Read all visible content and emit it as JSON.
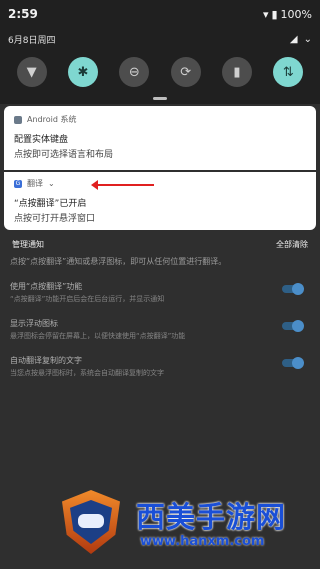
{
  "status": {
    "time": "2:59",
    "battery": "100%"
  },
  "qs": {
    "date": "6月8日周四",
    "tiles": [
      {
        "name": "wifi-icon",
        "glyph": "▼",
        "on": false
      },
      {
        "name": "bluetooth-icon",
        "glyph": "✱",
        "on": true
      },
      {
        "name": "dnd-icon",
        "glyph": "⊖",
        "on": false
      },
      {
        "name": "rotate-icon",
        "glyph": "⟳",
        "on": false
      },
      {
        "name": "battery-saver-icon",
        "glyph": "▮",
        "on": false
      },
      {
        "name": "data-icon",
        "glyph": "⇅",
        "on": true
      }
    ]
  },
  "notifications": [
    {
      "app": "Android 系统",
      "title": "配置实体键盘",
      "text": "点按即可选择语言和布局"
    },
    {
      "app": "翻译",
      "title": "“点按翻译”已开启",
      "text": "点按可打开悬浮窗口"
    }
  ],
  "manage": {
    "left": "管理通知",
    "right": "全部清除"
  },
  "background": {
    "intro": "点按“点按翻译”通知或悬浮图标，即可从任何位置进行翻译。",
    "settings": [
      {
        "title": "使用“点按翻译”功能",
        "desc": "“点按翻译”功能开启后会在后台运行，并显示通知"
      },
      {
        "title": "显示浮动图标",
        "desc": "悬浮图标会停留在屏幕上，以便快速使用“点按翻译”功能"
      },
      {
        "title": "自动翻译复制的文字",
        "desc": "当您点按悬浮图标时，系统会自动翻译复制的文字"
      }
    ]
  },
  "watermark": {
    "title": "西美手游网",
    "url": "www.hanxm.com"
  }
}
